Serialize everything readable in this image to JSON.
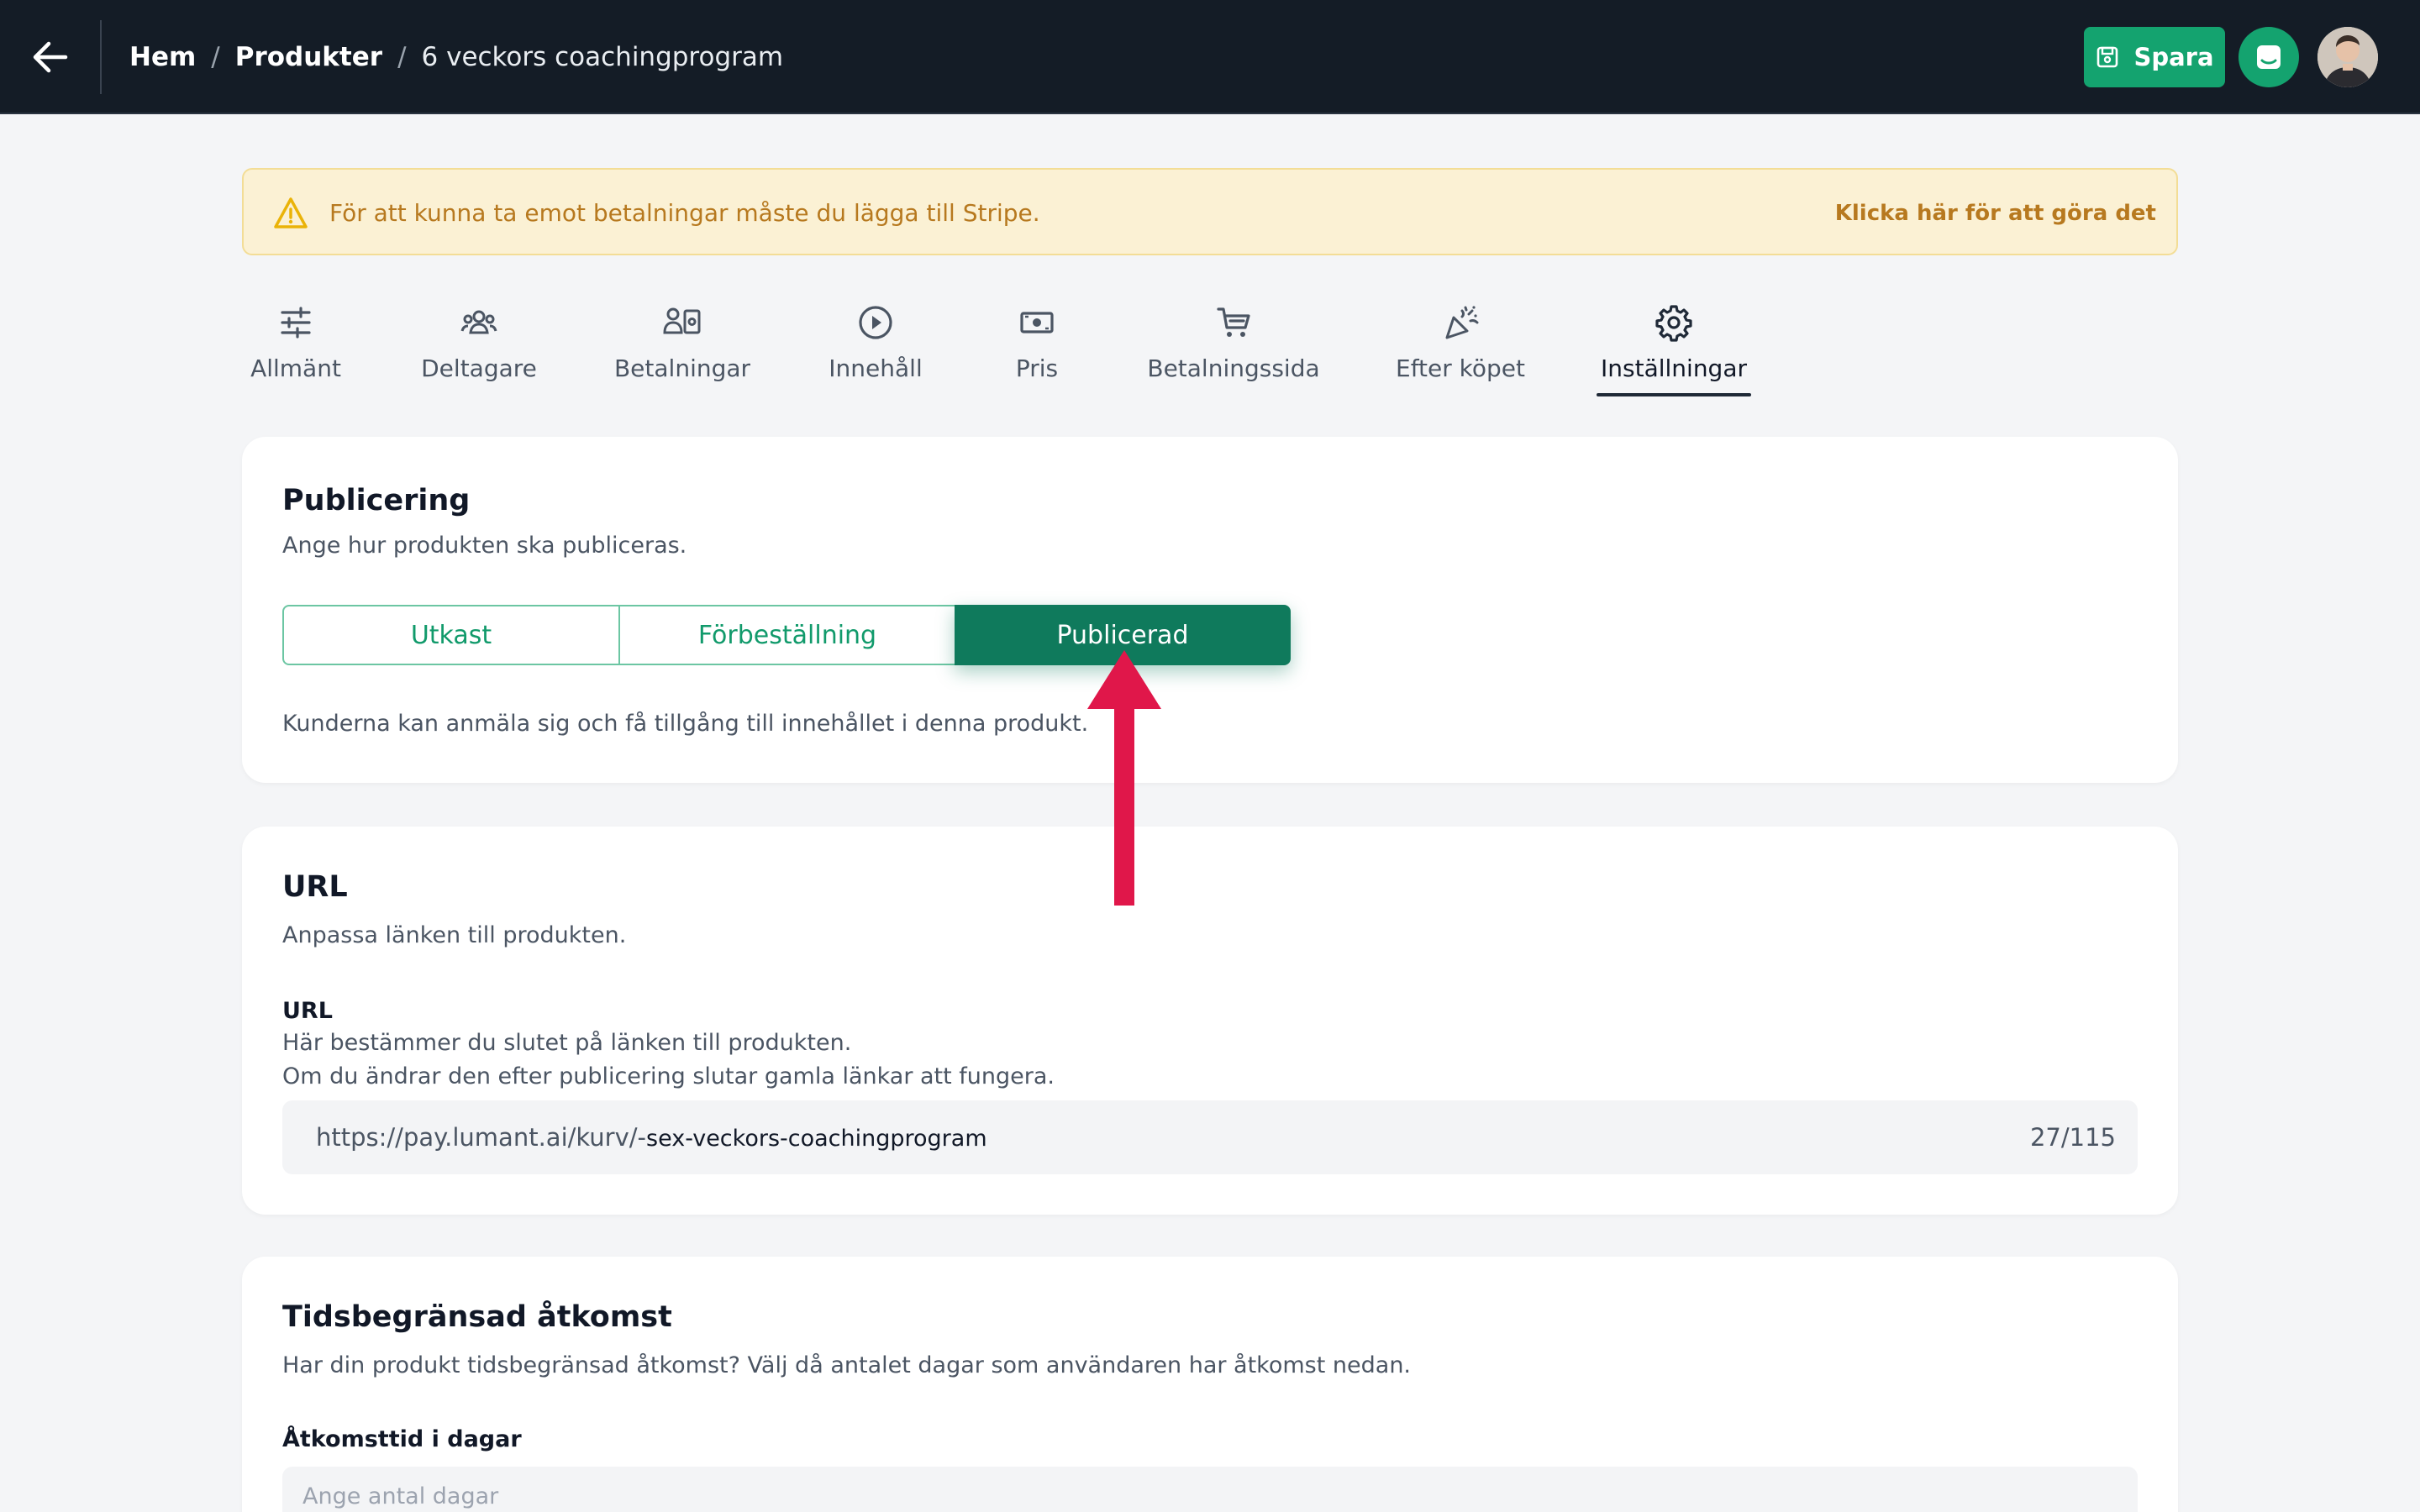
{
  "header": {
    "breadcrumb": [
      "Hem",
      "Produkter",
      "6 veckors coachingprogram"
    ],
    "separator": "/",
    "save_label": "Spara"
  },
  "banner": {
    "message": "För att kunna ta emot betalningar måste du lägga till Stripe.",
    "link": "Klicka här för att göra det"
  },
  "tabs": [
    {
      "label": "Allmänt",
      "icon": "sliders-icon"
    },
    {
      "label": "Deltagare",
      "icon": "users-icon"
    },
    {
      "label": "Betalningar",
      "icon": "payments-icon"
    },
    {
      "label": "Innehåll",
      "icon": "play-circle-icon"
    },
    {
      "label": "Pris",
      "icon": "cash-icon"
    },
    {
      "label": "Betalningssida",
      "icon": "cart-icon"
    },
    {
      "label": "Efter köpet",
      "icon": "party-popper-icon"
    },
    {
      "label": "Inställningar",
      "icon": "gear-icon",
      "active": true
    }
  ],
  "publishing": {
    "title": "Publicering",
    "description": "Ange hur produkten ska publiceras.",
    "options": [
      "Utkast",
      "Förbeställning",
      "Publicerad"
    ],
    "selected": "Publicerad",
    "status_text": "Kunderna kan anmäla sig och få tillgång till innehållet i denna produkt."
  },
  "url_section": {
    "title": "URL",
    "description": "Anpassa länken till produkten.",
    "field_label": "URL",
    "help_line1": "Här bestämmer du slutet på länken till produkten.",
    "help_line2": "Om du ändrar den efter publicering slutar gamla länkar att fungera.",
    "prefix": "https://pay.lumant.ai/kurv/-",
    "value": "sex-veckors-coachingprogram",
    "counter": "27/115"
  },
  "access_section": {
    "title": "Tidsbegränsad åtkomst",
    "description": "Har din produkt tidsbegränsad åtkomst? Välj då antalet dagar som användaren har åtkomst nedan.",
    "field_label": "Åtkomsttid i dagar",
    "placeholder": "Ange antal dagar"
  },
  "colors": {
    "topbar": "#141c26",
    "brand_green": "#14a36f",
    "selected_segment": "#0f7a5c",
    "annotation_arrow": "#e0174a",
    "banner_bg": "#fbf1d4"
  }
}
